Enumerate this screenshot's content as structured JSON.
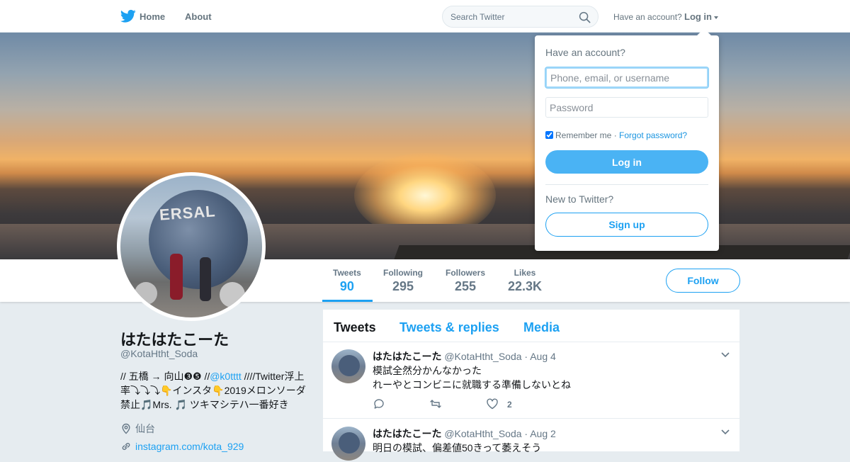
{
  "topbar": {
    "logo_icon": "twitter-bird-icon",
    "home_label": "Home",
    "about_label": "About",
    "search_placeholder": "Search Twitter",
    "have_account_text": "Have an account?",
    "login_label": "Log in"
  },
  "stats": [
    {
      "label": "Tweets",
      "value": "90"
    },
    {
      "label": "Following",
      "value": "295"
    },
    {
      "label": "Followers",
      "value": "255"
    },
    {
      "label": "Likes",
      "value": "22.3K"
    }
  ],
  "follow_label": "Follow",
  "profile": {
    "name": "はたはたこーた",
    "handle": "@KotaHtht_Soda",
    "bio_part1": "// 五橋 → 向山❸❺ //",
    "bio_link": "@k0tttt",
    "bio_part2": " ////Twitter浮上率⤵⤵⤵👇インスタ👇2019メロンソーダ禁止🎵Mrs. 🎵 ツキマシテハ一番好き",
    "location": "仙台",
    "website": "instagram.com/kota_929"
  },
  "timeline": {
    "tabs": [
      {
        "label": "Tweets"
      },
      {
        "label": "Tweets & replies"
      },
      {
        "label": "Media"
      }
    ],
    "tweets": [
      {
        "name": "はたはたこーた",
        "handle": "@KotaHtht_Soda",
        "dot": "·",
        "date": "Aug 4",
        "line1": "模試全然分かんなかった",
        "line2": "れーやとコンビニに就職する準備しないとね",
        "likes": "2"
      },
      {
        "name": "はたはたこーた",
        "handle": "@KotaHtht_Soda",
        "dot": "·",
        "date": "Aug 2",
        "line1": "明日の模試、偏差値50きって萎えそう",
        "line2": "",
        "likes": ""
      }
    ]
  },
  "login_popup": {
    "title": "Have an account?",
    "username_placeholder": "Phone, email, or username",
    "password_placeholder": "Password",
    "remember_label": "Remember me",
    "separator": "·",
    "forgot_label": "Forgot password?",
    "login_button": "Log in",
    "new_text": "New to Twitter?",
    "signup_button": "Sign up",
    "remember_checked": true
  },
  "colors": {
    "accent": "#1da1f2",
    "login_button_bg": "#4ab3f4",
    "background": "#e6ecf0"
  }
}
